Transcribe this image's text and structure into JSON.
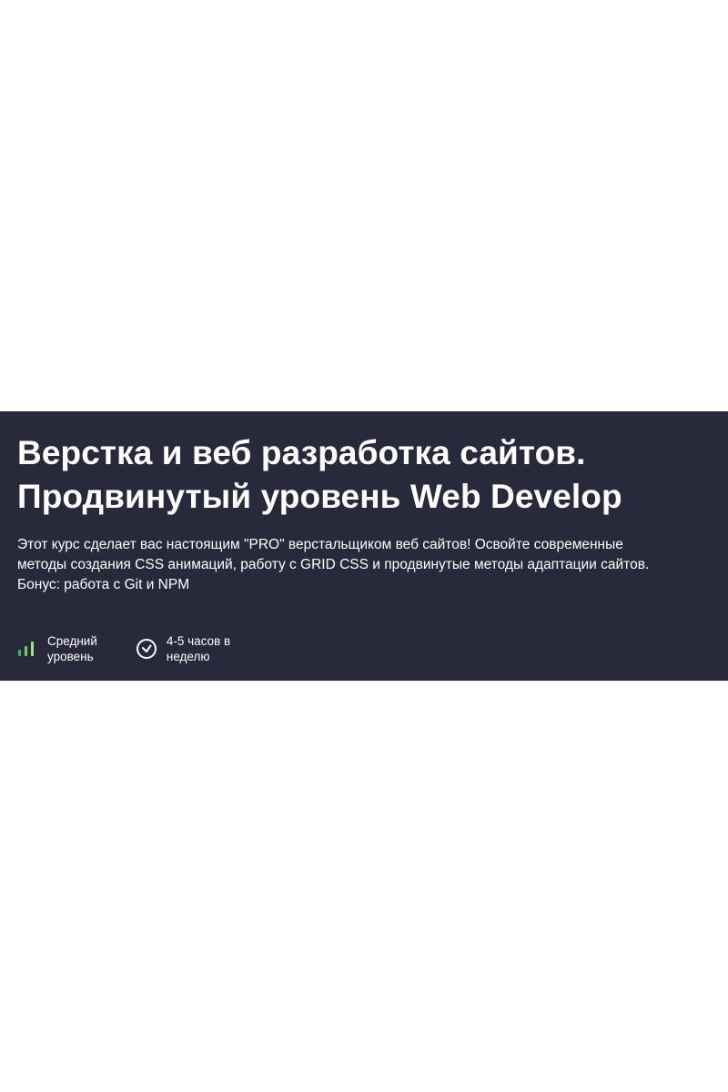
{
  "course": {
    "title_lines": [
      "Верстка и веб разработка сайтов.",
      "Продвинутый уровень Web Develop"
    ],
    "description_lines": [
      "Этот курс сделает вас настоящим \"PRO\" верстальщиком веб сайтов! Освойте современные",
      "методы создания CSS анимаций, работу с GRID CSS и продвинутые методы адаптации сайтов.",
      "Бонус: работа с Git и NPM"
    ],
    "meta": {
      "level": {
        "icon": "signal-bars-icon",
        "lines": [
          "Средний",
          "уровень"
        ],
        "filled_bars": 3,
        "total_bars": 3
      },
      "time": {
        "icon": "clock-icon",
        "lines": [
          "4-5 часов в",
          "неделю"
        ]
      }
    }
  },
  "colors": {
    "banner_background": "#282a3c",
    "text": "#ffffff",
    "page_background": "#ffffff",
    "level_bar_low": "#3cb371",
    "level_bar_mid": "#6fcf6a",
    "level_bar_high": "#a6e27a"
  }
}
